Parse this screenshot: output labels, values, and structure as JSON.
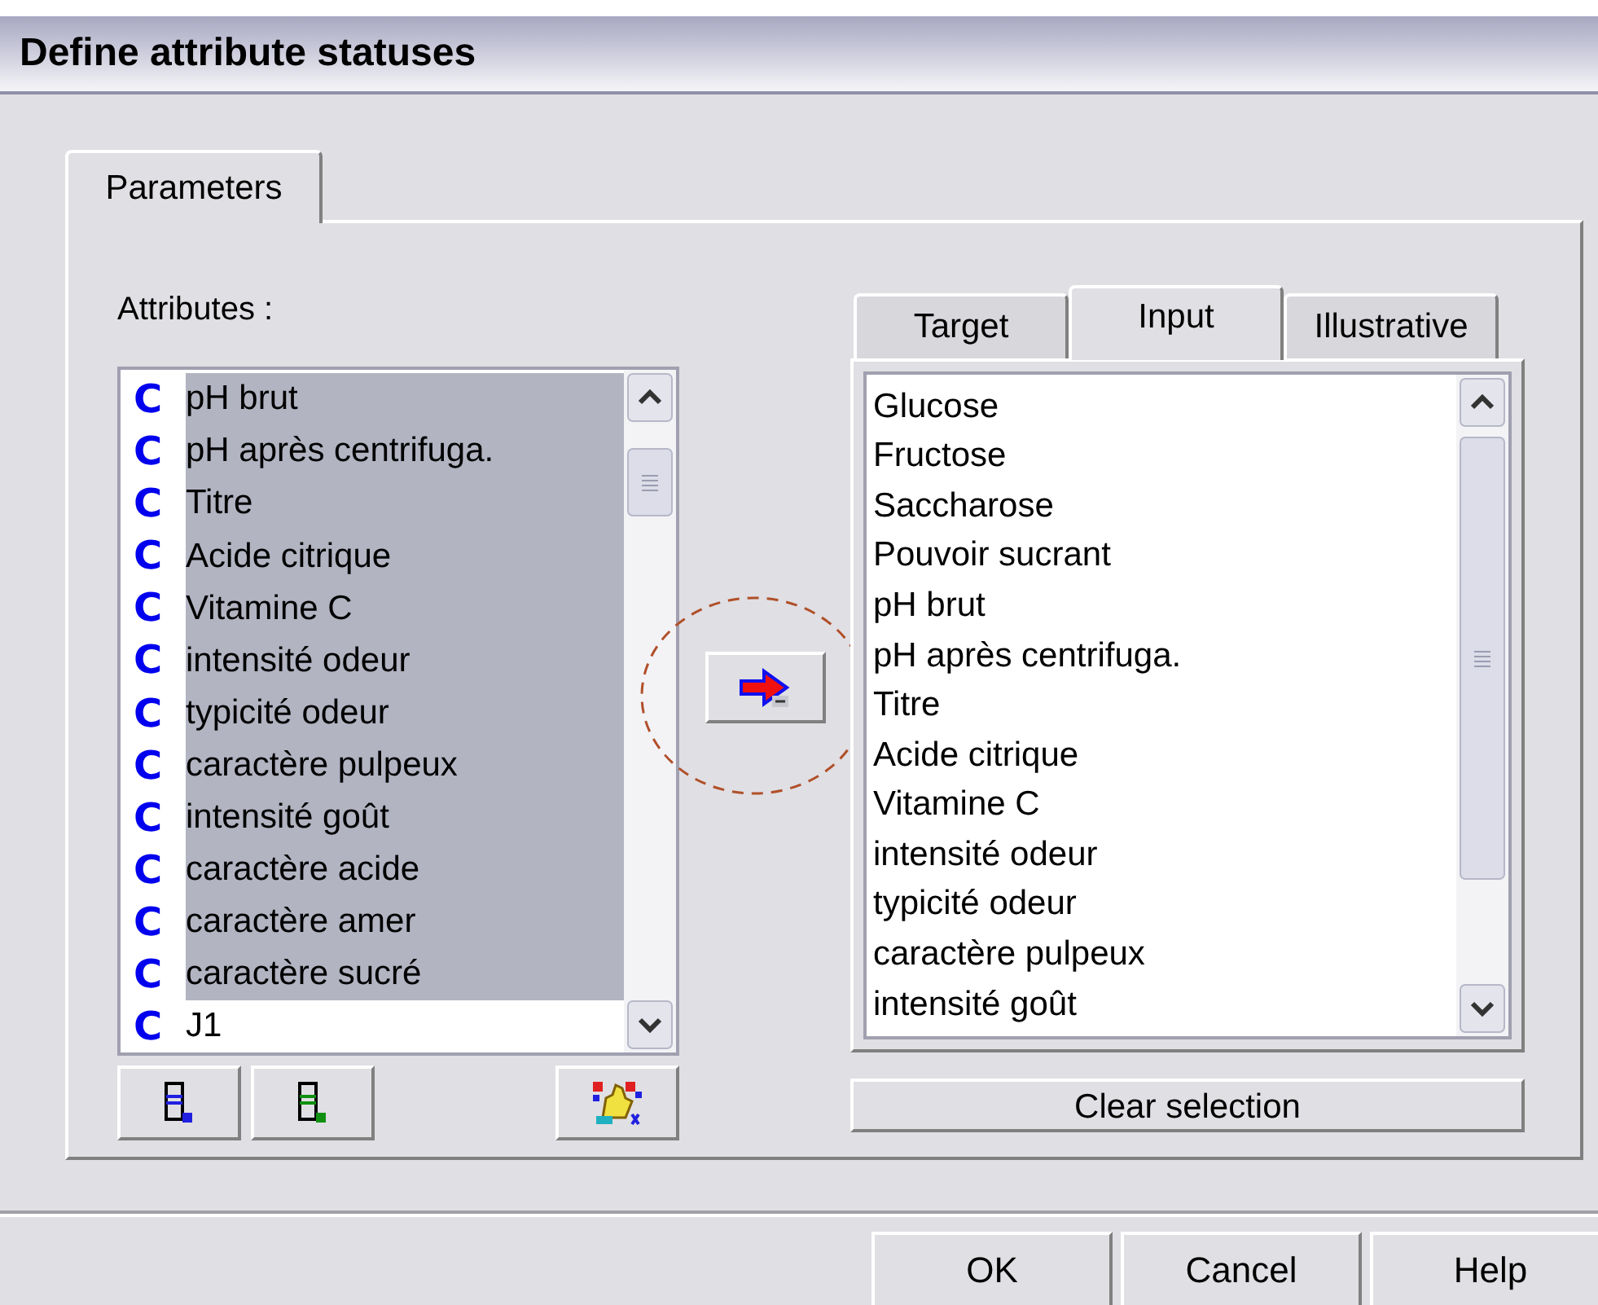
{
  "window": {
    "title": "Define attribute statuses"
  },
  "tabs": [
    {
      "label": "Parameters",
      "selected": true
    }
  ],
  "attributes": {
    "label": "Attributes :",
    "items": [
      {
        "type": "C",
        "name": "pH brut",
        "selected": true
      },
      {
        "type": "C",
        "name": "pH après centrifuga.",
        "selected": true
      },
      {
        "type": "C",
        "name": "Titre",
        "selected": true
      },
      {
        "type": "C",
        "name": "Acide citrique",
        "selected": true
      },
      {
        "type": "C",
        "name": "Vitamine C",
        "selected": true
      },
      {
        "type": "C",
        "name": "intensité odeur",
        "selected": true
      },
      {
        "type": "C",
        "name": "typicité odeur",
        "selected": true
      },
      {
        "type": "C",
        "name": "caractère pulpeux",
        "selected": true
      },
      {
        "type": "C",
        "name": "intensité goût",
        "selected": true
      },
      {
        "type": "C",
        "name": "caractère acide",
        "selected": true
      },
      {
        "type": "C",
        "name": "caractère amer",
        "selected": true
      },
      {
        "type": "C",
        "name": "caractère sucré",
        "selected": true
      },
      {
        "type": "C",
        "name": "J1",
        "selected": false
      }
    ]
  },
  "status_tabs": [
    {
      "label": "Target",
      "selected": false
    },
    {
      "label": "Input",
      "selected": true
    },
    {
      "label": "Illustrative",
      "selected": false
    }
  ],
  "status_list": {
    "items": [
      "Glucose",
      "Fructose",
      "Saccharose",
      "Pouvoir sucrant",
      "pH brut",
      "pH après centrifuga.",
      "Titre",
      "Acide citrique",
      "Vitamine C",
      "intensité odeur",
      "typicité odeur",
      "caractère pulpeux",
      "intensité goût"
    ]
  },
  "clear_button": "Clear selection",
  "buttons": [
    "OK",
    "Cancel",
    "Help"
  ]
}
